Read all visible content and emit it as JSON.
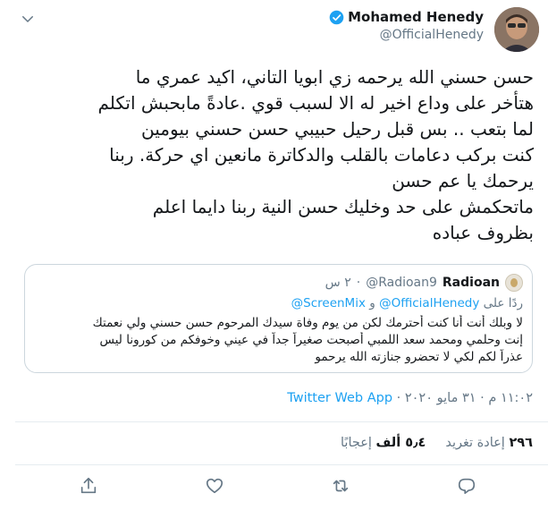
{
  "tweet": {
    "author": {
      "name": "Mohamed Henedy",
      "handle": "@OfficialHenedy",
      "verified_color": "#1da1f2"
    },
    "text_lines": [
      "حسن حسني الله يرحمه زي ابويا التاني، اكيد عمري ما",
      "هتأخر على وداع اخير له الا لسبب قوي .عادةً مابحبش اتكلم",
      "لما بتعب .. بس قبل رحيل حبيبي حسن حسني بيومين",
      "كنت بركب دعامات بالقلب والدكاترة مانعين اي حركة. ربنا",
      "يرحمك يا عم حسن",
      "ماتحكمش على حد وخليك حسن النية ربنا دايما اعلم",
      "بظروف عباده"
    ],
    "quote": {
      "name": "Radioan",
      "handle": "@Radioan9",
      "separator": "·",
      "time": "٢ س",
      "reply_prefix": "ردًا على",
      "reply_mention_1": "@OfficialHenedy",
      "reply_conjunction": "و",
      "reply_mention_2": "@ScreenMix",
      "text_lines": [
        "لا وبلك أنت أنا كنت أحترمك لكن من يوم وفاة سيدك المرحوم حسن حسني ولي نعمتك",
        "إنت وحلمي ومحمد سعد اللمبي أصبحت صغيراً جداً في عيني وخوفكم من كورونا ليس",
        "عذراً لكم لكي لا تحضرو جنازته الله يرحمو"
      ]
    },
    "meta": {
      "time": "١١:٠٢ م",
      "separator": "·",
      "date": "٣١ مايو ٢٠٢٠",
      "separator2": "·",
      "source": "Twitter Web App"
    },
    "stats": {
      "retweets_count": "٢٩٦",
      "retweets_label": "إعادة تغريد",
      "likes_count": "٥٫٤ ألف",
      "likes_label": "إعجابًا"
    },
    "actions": {
      "icon_color": "#657786",
      "icons": [
        "share-icon",
        "like-icon",
        "retweet-icon",
        "reply-icon"
      ]
    }
  }
}
